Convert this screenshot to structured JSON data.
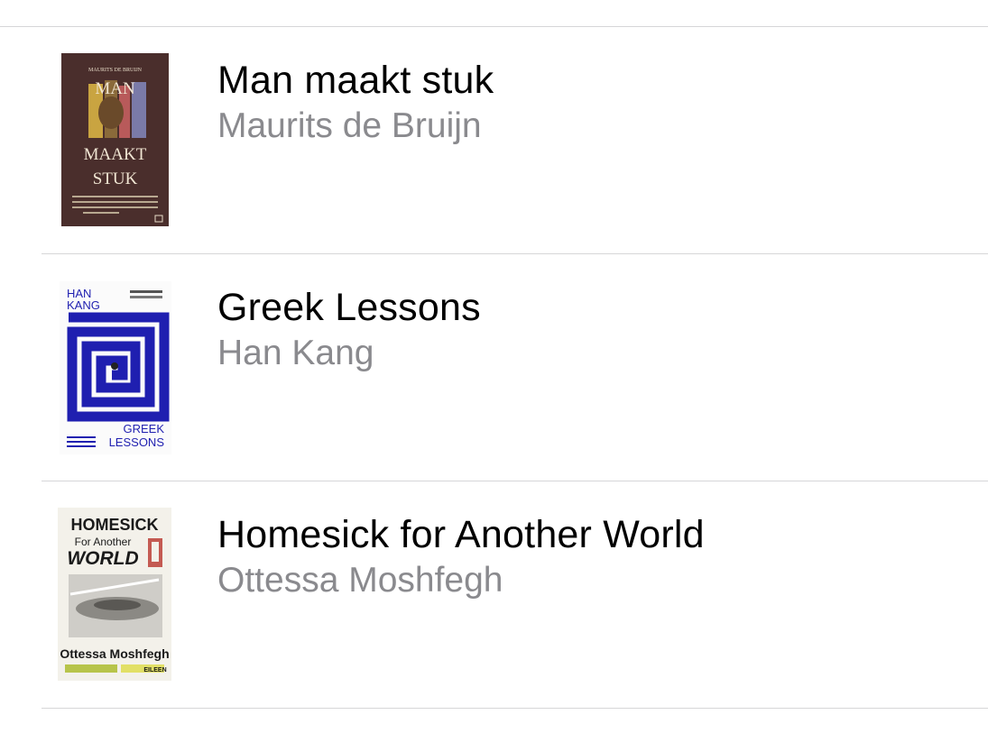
{
  "books": [
    {
      "title": "Man maakt stuk",
      "author": "Maurits de Bruijn",
      "cover": {
        "author_line": "MAURITS DE BRUIJN",
        "title_lines": [
          "MAN",
          "MAAKT",
          "STUK"
        ],
        "background": "#4a2e2c"
      }
    },
    {
      "title": "Greek Lessons",
      "author": "Han Kang",
      "cover": {
        "author_lines": [
          "HAN",
          "KANG"
        ],
        "title_lines": [
          "GREEK",
          "LESSONS"
        ],
        "accent": "#1f1fb0"
      }
    },
    {
      "title": "Homesick for Another World",
      "author": "Ottessa Moshfegh",
      "cover": {
        "title_lines": [
          "HOMESICK",
          "For Another",
          "WORLD"
        ],
        "author_line": "Ottessa Moshfegh",
        "tag": "EILEEN"
      }
    }
  ]
}
